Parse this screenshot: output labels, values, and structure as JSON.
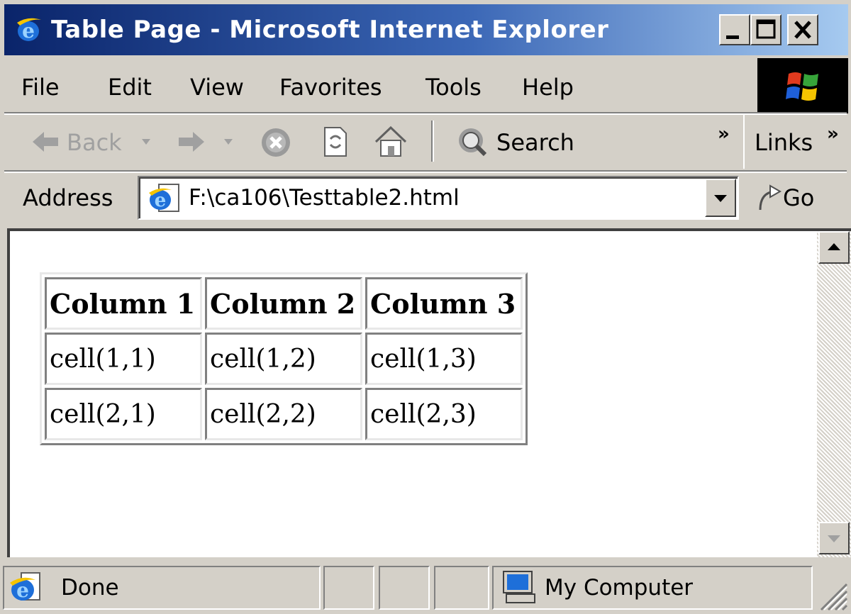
{
  "window": {
    "title": "Table Page - Microsoft Internet Explorer"
  },
  "menu": [
    "File",
    "Edit",
    "View",
    "Favorites",
    "Tools",
    "Help"
  ],
  "toolbar": {
    "back_label": "Back",
    "search_label": "Search",
    "links_label": "Links",
    "chevron": "»"
  },
  "address": {
    "label": "Address",
    "value": "F:\\ca106\\Testtable2.html",
    "go_label": "Go"
  },
  "table": {
    "headers": [
      "Column 1",
      "Column 2",
      "Column 3"
    ],
    "rows": [
      [
        "cell(1,1)",
        "cell(1,2)",
        "cell(1,3)"
      ],
      [
        "cell(2,1)",
        "cell(2,2)",
        "cell(2,3)"
      ]
    ]
  },
  "status": {
    "text": "Done",
    "zone": "My Computer"
  },
  "icons": [
    "ie-icon",
    "minimize-icon",
    "maximize-icon",
    "close-icon",
    "windows-logo-icon",
    "back-arrow-icon",
    "forward-arrow-icon",
    "stop-icon",
    "refresh-icon",
    "home-icon",
    "search-icon",
    "go-arrow-icon",
    "computer-icon",
    "resize-grip-icon"
  ],
  "colors": {
    "titlebar_start": "#0a246a",
    "titlebar_end": "#a6caf0",
    "chrome": "#d4d0c8",
    "content_bg": "#ffffff"
  }
}
